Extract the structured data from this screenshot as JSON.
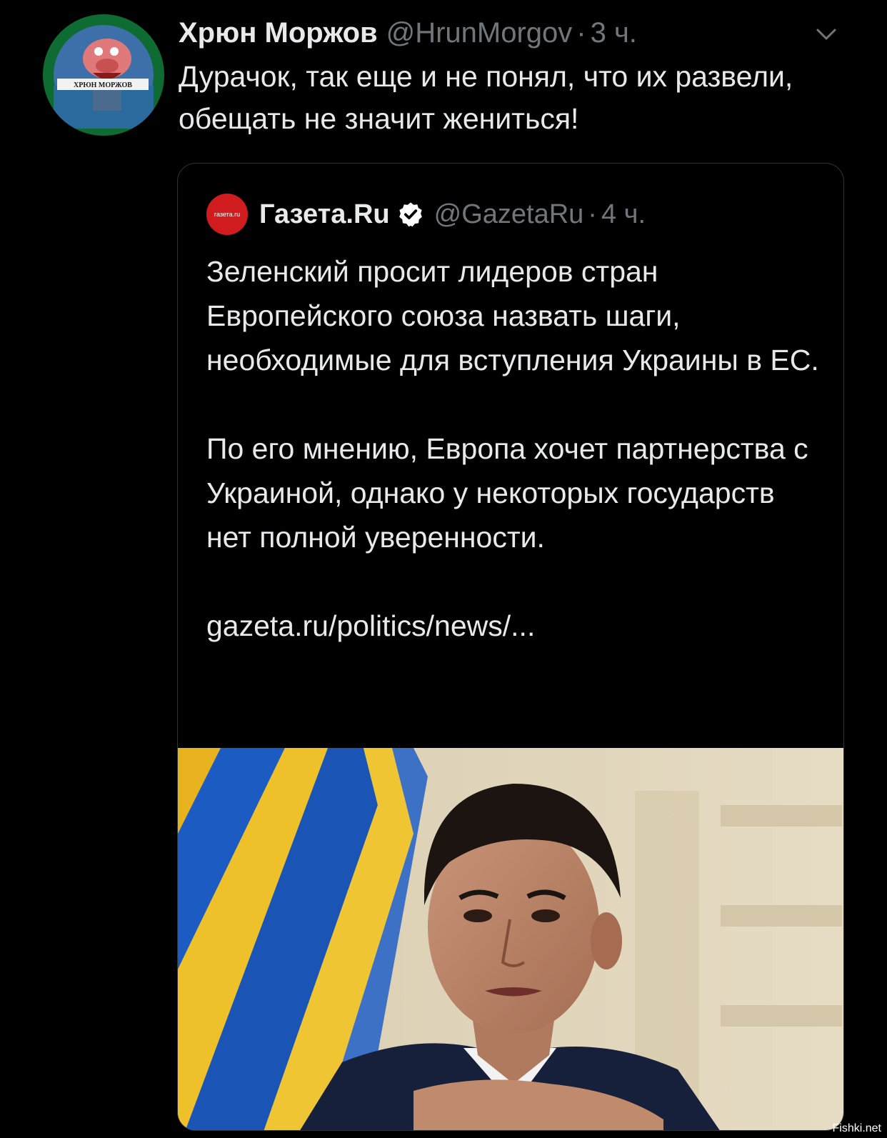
{
  "tweet": {
    "display_name": "Хрюн Моржов",
    "handle": "@HrunMorgov",
    "separator": "·",
    "time": "3 ч.",
    "text": "Дурачок, так еще и не понял, что их развели, обещать не значит жениться!",
    "avatar_icon": "pig-cartoon-avatar",
    "avatar_caption": "ХРЮН МОРЖОВ",
    "menu_icon": "chevron-down-icon"
  },
  "quote": {
    "display_name": "Газета.Ru",
    "verified_icon": "verified-badge-icon",
    "handle": "@GazetaRu",
    "separator": "·",
    "time": "4 ч.",
    "avatar_label": "газета.ru",
    "paragraph1": "Зеленский просит лидеров стран Европейского союза назвать шаги, необходимые для вступления Украины в ЕС.",
    "paragraph2": "По его мнению, Европа хочет партнерства с Украиной, однако у некоторых государств нет полной уверенности.",
    "link": "gazeta.ru/politics/news/...",
    "image_icon": "photo-man-suit-flag"
  },
  "watermark": "Fishki.net",
  "colors": {
    "background": "#000000",
    "text_primary": "#e7e9ea",
    "text_secondary": "#71767b",
    "border": "#2f3336",
    "verified_badge": "#ffffff",
    "gazeta_red": "#d01c1f"
  }
}
